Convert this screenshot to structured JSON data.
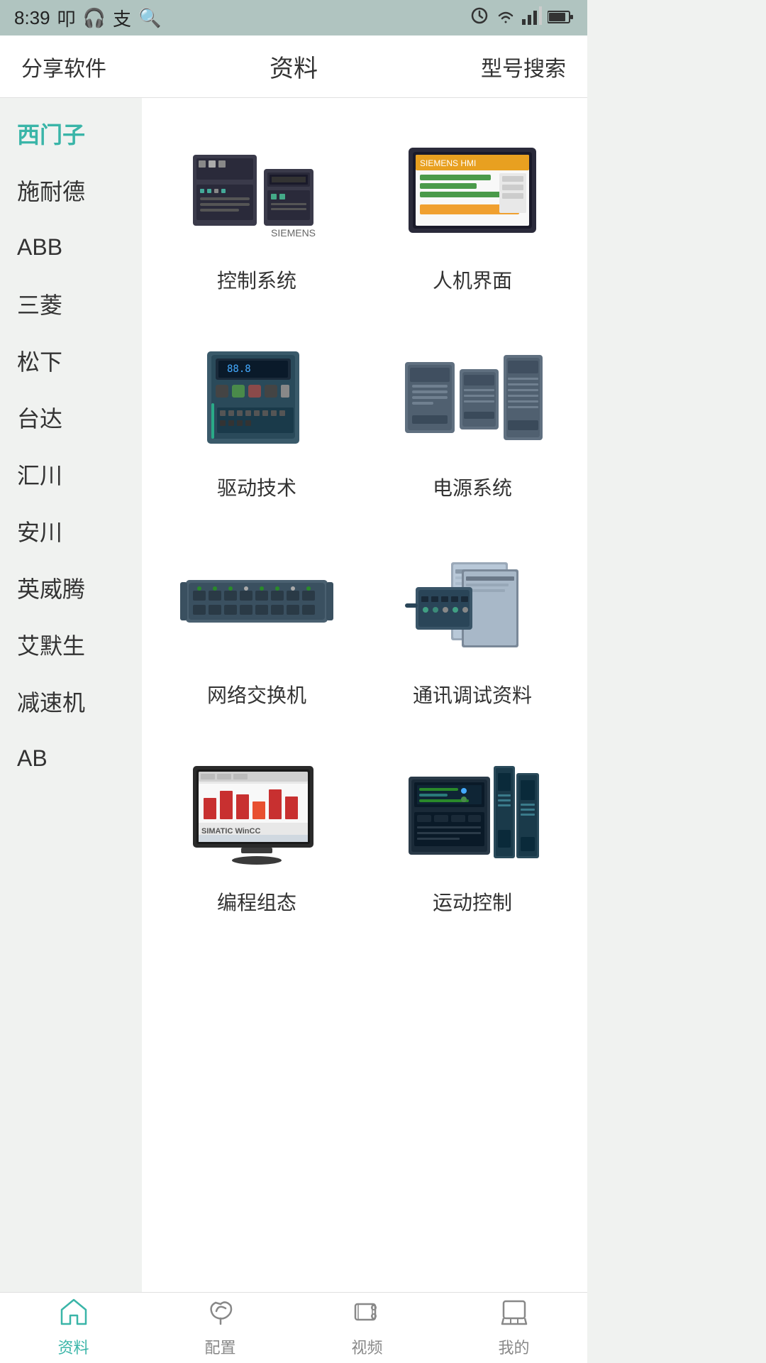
{
  "statusBar": {
    "time": "8:39",
    "icons": [
      "叩",
      "headphone",
      "支",
      "chat"
    ]
  },
  "topNav": {
    "left": "分享软件",
    "center": "资料",
    "right": "型号搜索"
  },
  "sidebar": {
    "items": [
      {
        "id": "siemens",
        "label": "西门子",
        "active": true
      },
      {
        "id": "schneider",
        "label": "施耐德",
        "active": false
      },
      {
        "id": "abb",
        "label": "ABB",
        "active": false
      },
      {
        "id": "mitsubishi",
        "label": "三菱",
        "active": false
      },
      {
        "id": "panasonic",
        "label": "松下",
        "active": false
      },
      {
        "id": "delta",
        "label": "台达",
        "active": false
      },
      {
        "id": "inovance",
        "label": "汇川",
        "active": false
      },
      {
        "id": "yaskawa",
        "label": "安川",
        "active": false
      },
      {
        "id": "invt",
        "label": "英威腾",
        "active": false
      },
      {
        "id": "emerson",
        "label": "艾默生",
        "active": false
      },
      {
        "id": "reducer",
        "label": "减速机",
        "active": false
      },
      {
        "id": "ab",
        "label": "AB",
        "active": false
      }
    ]
  },
  "content": {
    "categories": [
      {
        "id": "control-system",
        "label": "控制系统",
        "color": "#4a4a5a"
      },
      {
        "id": "hmi",
        "label": "人机界面",
        "color": "#e8a020"
      },
      {
        "id": "drive",
        "label": "驱动技术",
        "color": "#3a6a8a"
      },
      {
        "id": "power-supply",
        "label": "电源系统",
        "color": "#607080"
      },
      {
        "id": "network-switch",
        "label": "网络交换机",
        "color": "#4a6070"
      },
      {
        "id": "comm-debug",
        "label": "通讯调试资料",
        "color": "#5a7080"
      },
      {
        "id": "programming",
        "label": "编程组态",
        "color": "#c8302a"
      },
      {
        "id": "motion-control",
        "label": "运动控制",
        "color": "#2a4a5a"
      }
    ]
  },
  "bottomTabs": {
    "items": [
      {
        "id": "data",
        "label": "资料",
        "active": true
      },
      {
        "id": "config",
        "label": "配置",
        "active": false
      },
      {
        "id": "video",
        "label": "视频",
        "active": false
      },
      {
        "id": "mine",
        "label": "我的",
        "active": false
      }
    ]
  }
}
